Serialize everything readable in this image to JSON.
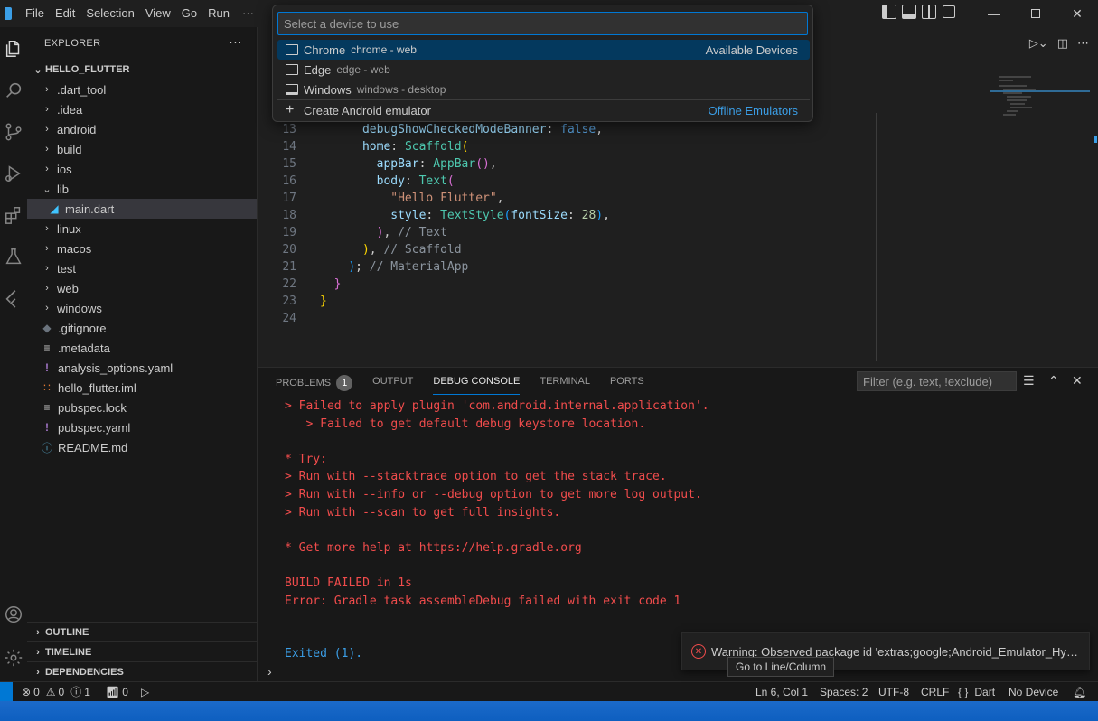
{
  "titlebar": {
    "menu": [
      "File",
      "Edit",
      "Selection",
      "View",
      "Go",
      "Run"
    ],
    "more": "···"
  },
  "sidebar": {
    "title": "EXPLORER",
    "more": "···",
    "root": "HELLO_FLUTTER",
    "items": [
      {
        "label": ".dart_tool",
        "type": "folder"
      },
      {
        "label": ".idea",
        "type": "folder"
      },
      {
        "label": "android",
        "type": "folder"
      },
      {
        "label": "build",
        "type": "folder"
      },
      {
        "label": "ios",
        "type": "folder"
      },
      {
        "label": "lib",
        "type": "folder-open"
      },
      {
        "label": "main.dart",
        "type": "dart"
      },
      {
        "label": "linux",
        "type": "folder"
      },
      {
        "label": "macos",
        "type": "folder"
      },
      {
        "label": "test",
        "type": "folder"
      },
      {
        "label": "web",
        "type": "folder"
      },
      {
        "label": "windows",
        "type": "folder"
      },
      {
        "label": ".gitignore",
        "type": "git"
      },
      {
        "label": ".metadata",
        "type": "text"
      },
      {
        "label": "analysis_options.yaml",
        "type": "yaml"
      },
      {
        "label": "hello_flutter.iml",
        "type": "rss"
      },
      {
        "label": "pubspec.lock",
        "type": "text"
      },
      {
        "label": "pubspec.yaml",
        "type": "yaml"
      },
      {
        "label": "README.md",
        "type": "info"
      }
    ],
    "sections": [
      "OUTLINE",
      "TIMELINE",
      "DEPENDENCIES"
    ]
  },
  "quickpick": {
    "placeholder": "Select a device to use",
    "items": [
      {
        "label": "Chrome",
        "desc": "chrome - web",
        "right": "Available Devices"
      },
      {
        "label": "Edge",
        "desc": "edge - web",
        "right": ""
      },
      {
        "label": "Windows",
        "desc": "windows - desktop",
        "right": ""
      },
      {
        "label": "Create Android emulator",
        "desc": "",
        "right": "Offline Emulators"
      }
    ]
  },
  "editor": {
    "line_numbers": [
      "13",
      "14",
      "15",
      "16",
      "17",
      "18",
      "19",
      "20",
      "21",
      "22",
      "23",
      "24"
    ]
  },
  "panel": {
    "tabs": [
      "PROBLEMS",
      "OUTPUT",
      "DEBUG CONSOLE",
      "TERMINAL",
      "PORTS"
    ],
    "problems_count": "1",
    "filter_placeholder": "Filter (e.g. text, !exclude)",
    "console_lines": [
      "> Failed to apply plugin 'com.android.internal.application'.",
      "   > Failed to get default debug keystore location.",
      "",
      "* Try:",
      "> Run with --stacktrace option to get the stack trace.",
      "> Run with --info or --debug option to get more log output.",
      "> Run with --scan to get full insights.",
      "",
      "* Get more help at https://help.gradle.org",
      "",
      "BUILD FAILED in 1s",
      "Error: Gradle task assembleDebug failed with exit code 1",
      "",
      "",
      "Exited (1)."
    ]
  },
  "notification": {
    "text": "Warning: Observed package id 'extras;google;Android_Emulator_Hype..."
  },
  "tooltip": "Go to Line/Column",
  "statusbar": {
    "errors": "0",
    "warnings": "0",
    "info": "1",
    "ports": "0",
    "position": "Ln 6, Col 1",
    "spaces": "Spaces: 2",
    "encoding": "UTF-8",
    "eol": "CRLF",
    "language": "Dart",
    "language_icon": "{ }",
    "device": "No Device"
  }
}
